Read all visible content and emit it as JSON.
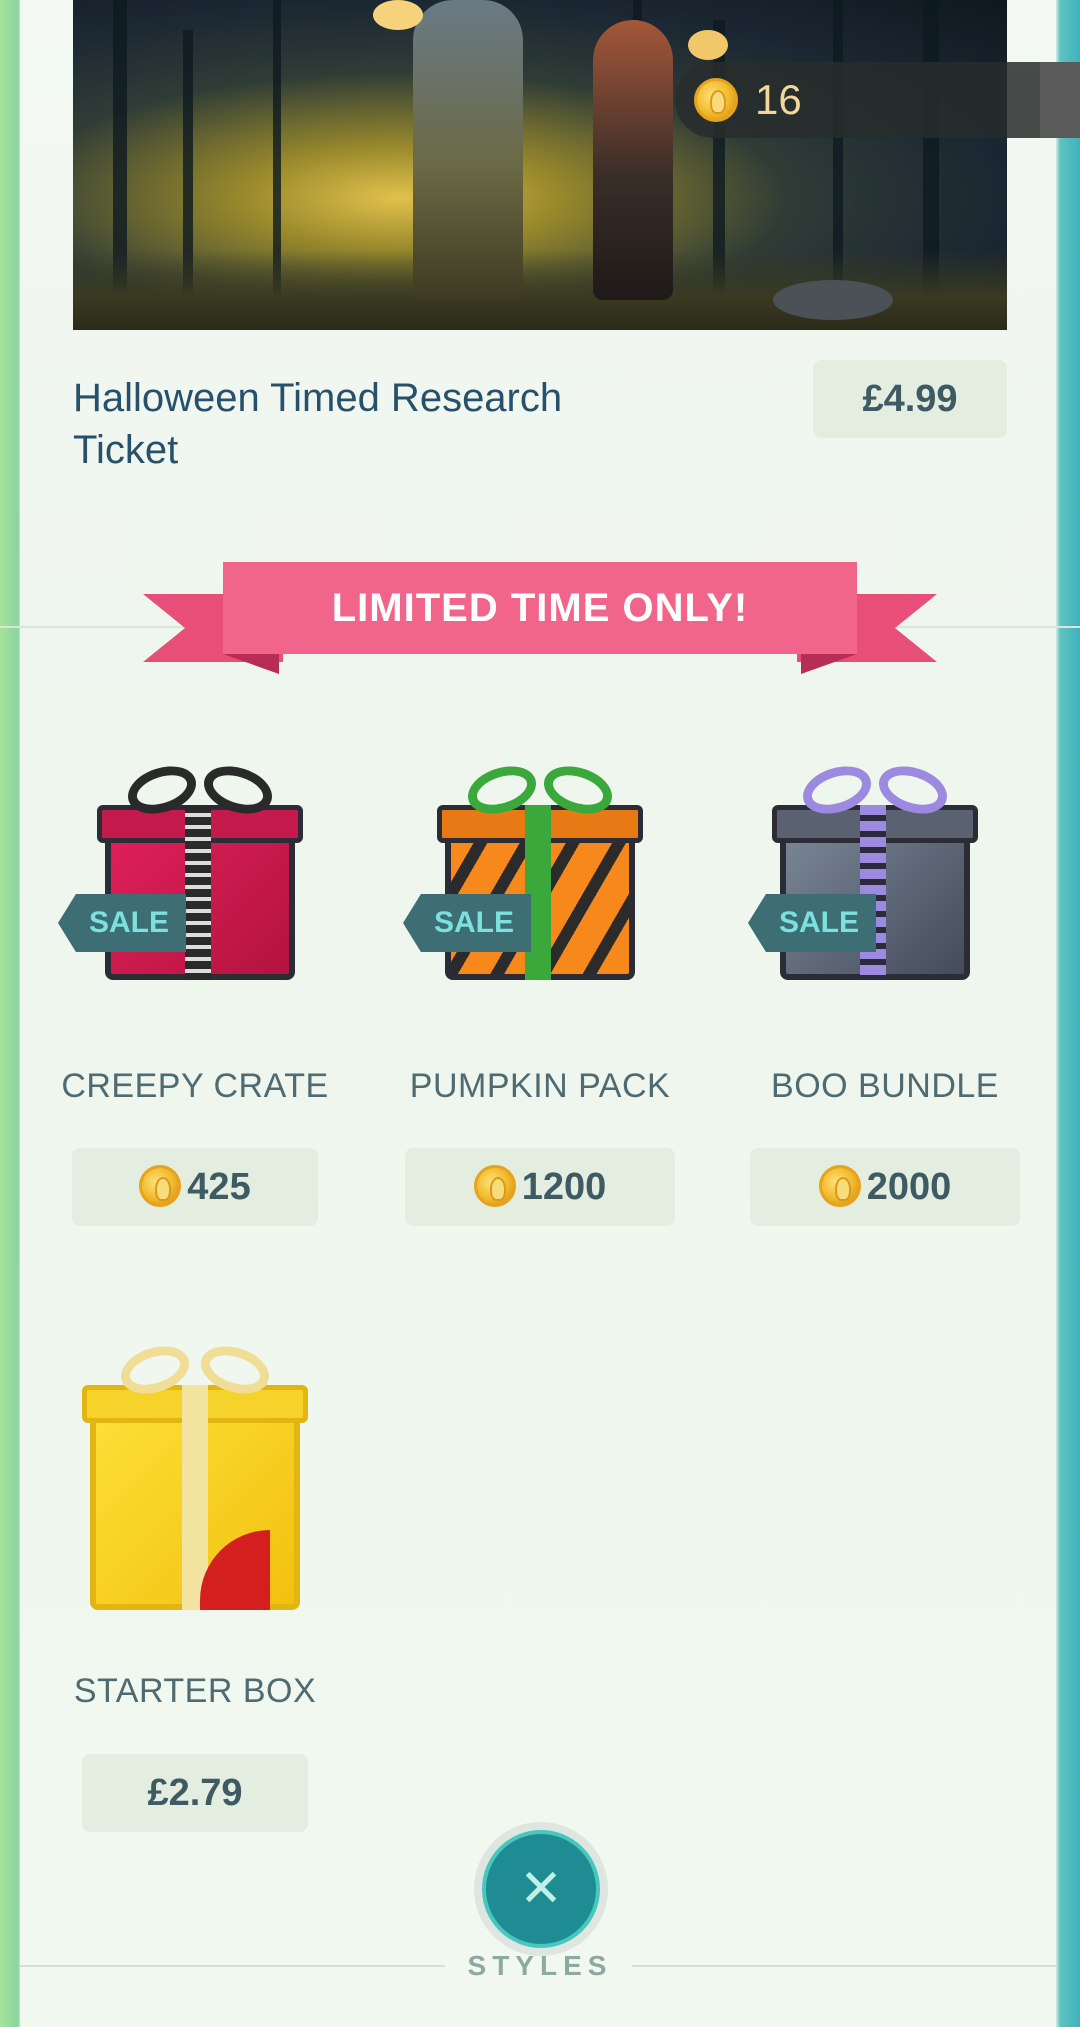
{
  "header": {
    "coin_balance": "16"
  },
  "featured": {
    "title": "Halloween Timed Research Ticket",
    "price": "£4.99"
  },
  "banner": {
    "label": "LIMITED TIME ONLY!"
  },
  "bundles": [
    {
      "name": "CREEPY CRATE",
      "price": "425",
      "badge": "SALE",
      "currency": "coin-icon"
    },
    {
      "name": "PUMPKIN PACK",
      "price": "1200",
      "badge": "SALE",
      "currency": "coin-icon"
    },
    {
      "name": "BOO BUNDLE",
      "price": "2000",
      "badge": "SALE",
      "currency": "coin-icon"
    },
    {
      "name": "STARTER BOX",
      "price": "£2.79",
      "badge": "",
      "currency": "money"
    }
  ],
  "footer": {
    "close_icon": "close-icon",
    "styles_label": "STYLES"
  },
  "colors": {
    "accent_teal": "#1f8c93",
    "ribbon_pink": "#f2658a",
    "title_text": "#27506a",
    "sale_badge": "#3d6e73"
  }
}
